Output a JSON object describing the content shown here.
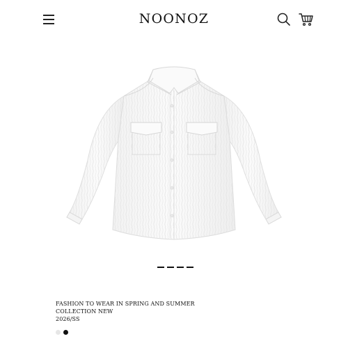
{
  "header": {
    "brand": "NOONOZ",
    "menu_icon": "hamburger-menu-icon",
    "search_icon": "search-icon",
    "cart_icon": "shopping-cart-icon"
  },
  "product": {
    "image": "white-textured-long-sleeve-shirt",
    "carousel_total": 4,
    "description_lines": [
      "FASHION TO WEAR IN SPRING AND SUMMER",
      "COLLECTION NEW",
      "2026/SS"
    ],
    "swatches": [
      {
        "color": "#e6e6e6"
      },
      {
        "color": "#111111"
      }
    ]
  }
}
